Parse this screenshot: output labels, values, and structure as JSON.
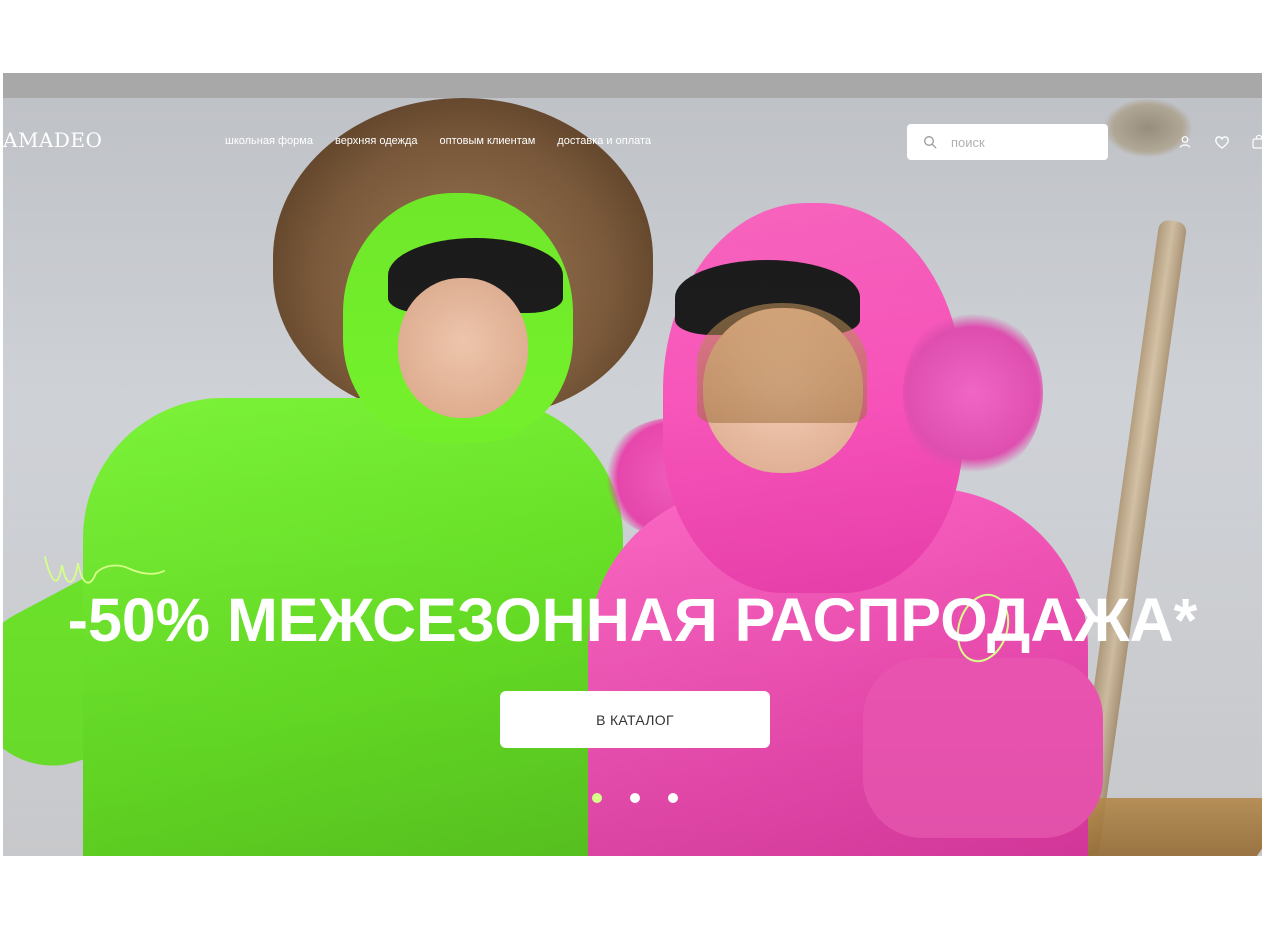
{
  "brand": {
    "logo_text": "AMADEO"
  },
  "nav": {
    "items": [
      {
        "label": "школьная форма"
      },
      {
        "label": "верхняя одежда"
      },
      {
        "label": "оптовым клиентам"
      },
      {
        "label": "доставка и оплата"
      }
    ]
  },
  "search": {
    "placeholder": "поиск",
    "value": ""
  },
  "header_icons": [
    "search-icon",
    "user-icon",
    "heart-icon",
    "bag-icon"
  ],
  "hero": {
    "headline": "-50% МЕЖСЕЗОННАЯ РАСПРОДАЖА*",
    "cta_label": "В КАТАЛОГ",
    "slides_total": 3,
    "active_slide": 1
  },
  "colors": {
    "accent": "#d6ff8a",
    "topbar": "#a8a8a8"
  }
}
